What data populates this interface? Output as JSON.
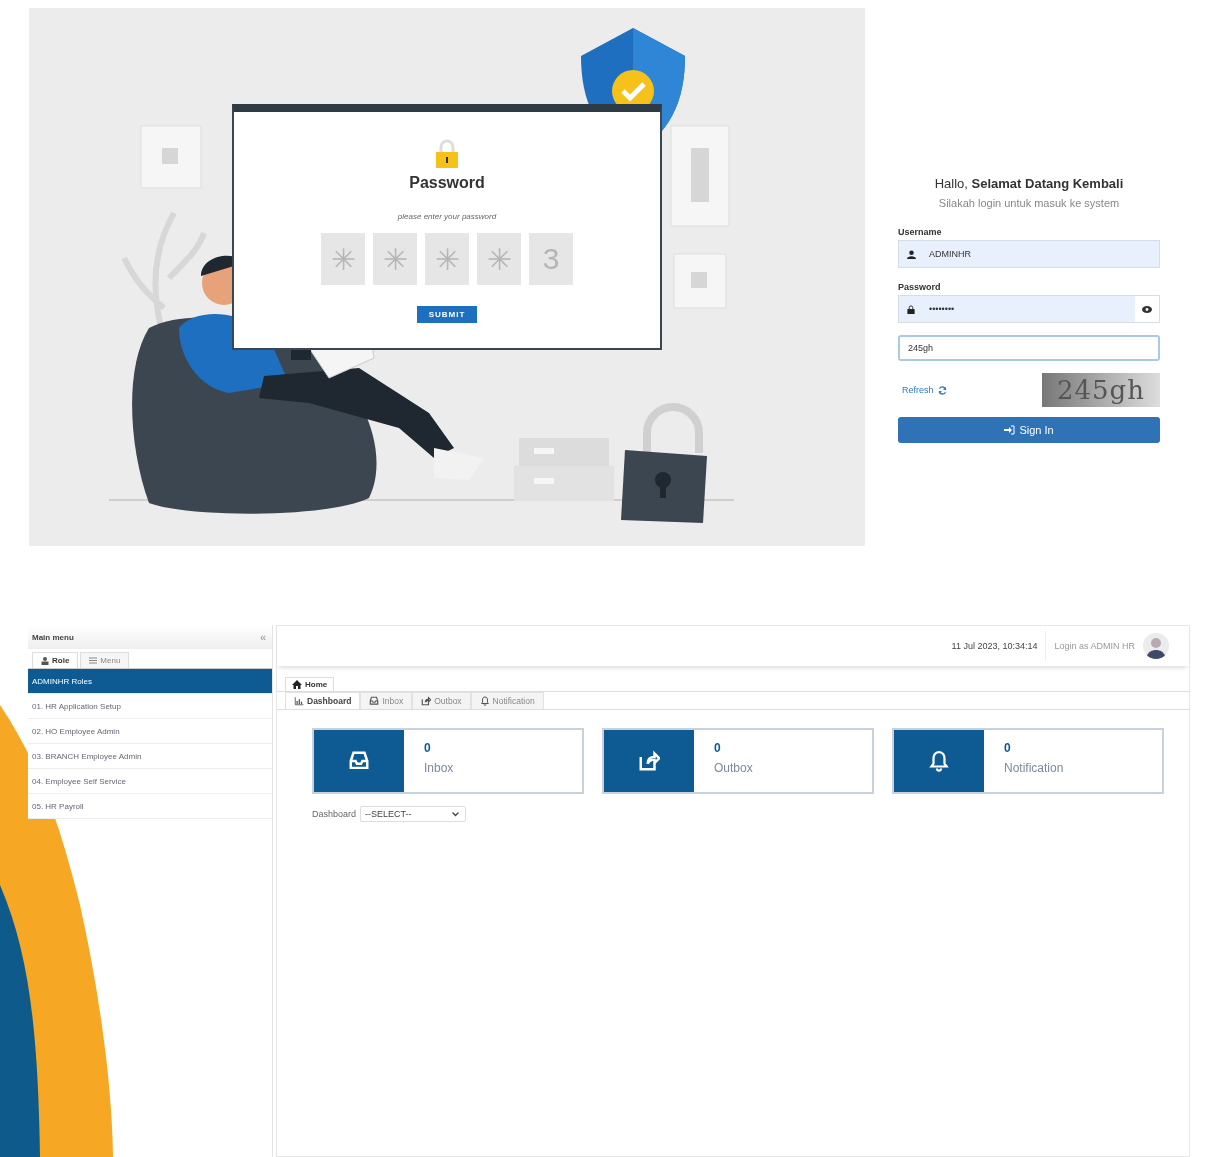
{
  "illustration": {
    "title": "Password",
    "hint": "please enter your password",
    "code_slots": [
      "✳",
      "✳",
      "✳",
      "✳",
      "3"
    ],
    "button": "SUBMIT"
  },
  "login": {
    "greeting": "Hallo, **Selamat Datang Kembali**",
    "subtitle": "Silakah login untuk masuk ke system",
    "username": {
      "label": "Username",
      "value": "ADMINHR"
    },
    "password": {
      "label": "Password",
      "value": "••••••••"
    },
    "captcha_input": {
      "value": "245gh"
    },
    "refresh": "Refresh",
    "captcha_text": "245gh",
    "sign_in": "Sign In"
  },
  "sidebar": {
    "title": "Main menu",
    "collapse": "«",
    "tabs": [
      {
        "label": "Role",
        "selected": true
      },
      {
        "label": "Menu",
        "selected": false
      }
    ],
    "items": [
      {
        "label": "ADMINHR Roles",
        "selected": true
      },
      {
        "label": "01. HR Application Setup",
        "selected": false
      },
      {
        "label": "02. HO Employee Admin",
        "selected": false
      },
      {
        "label": "03. BRANCH Employee Admin",
        "selected": false
      },
      {
        "label": "04. Employee Self Service",
        "selected": false
      },
      {
        "label": "05. HR Payroll",
        "selected": false
      }
    ]
  },
  "header": {
    "datetime": "11 Jul 2023, 10:34:14",
    "login_as": "Login as ADMIN HR"
  },
  "page_tab": "Home",
  "tabs": [
    {
      "kind": "dashboard",
      "label": "Dashboard",
      "selected": true
    },
    {
      "kind": "inbox",
      "label": "Inbox",
      "selected": false
    },
    {
      "kind": "outbox",
      "label": "Outbox",
      "selected": false
    },
    {
      "kind": "notification",
      "label": "Notification",
      "selected": false
    }
  ],
  "cards": [
    {
      "kind": "inbox",
      "count": "0",
      "label": "Inbox"
    },
    {
      "kind": "outbox",
      "count": "0",
      "label": "Outbox"
    },
    {
      "kind": "notification",
      "count": "0",
      "label": "Notification"
    }
  ],
  "filter": {
    "label": "Dashboard",
    "value": "--SELECT--"
  }
}
